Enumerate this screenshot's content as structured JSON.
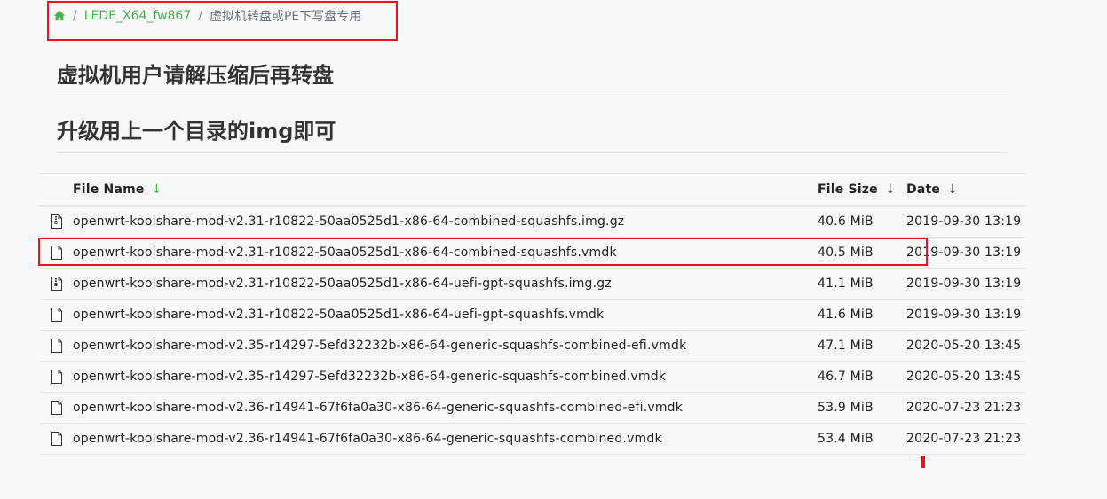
{
  "breadcrumb": {
    "home_icon": "home-icon",
    "separator": "/",
    "items": [
      {
        "label": "LEDE_X64_fw867",
        "color": "#4caf50"
      },
      {
        "label": "虚拟机转盘或PE下写盘专用"
      }
    ]
  },
  "headings": [
    "虚拟机用户请解压缩后再转盘",
    "升级用上一个目录的img即可"
  ],
  "table": {
    "columns": {
      "name": "File Name",
      "name_sort": "↓",
      "size": "File Size",
      "size_sort": "↓",
      "date": "Date",
      "date_sort": "↓"
    },
    "rows": [
      {
        "icon": "archive-icon",
        "name": "openwrt-koolshare-mod-v2.31-r10822-50aa0525d1-x86-64-combined-squashfs.img.gz",
        "size": "40.6 MiB",
        "date": "2019-09-30 13:19"
      },
      {
        "icon": "file-icon",
        "name": "openwrt-koolshare-mod-v2.31-r10822-50aa0525d1-x86-64-combined-squashfs.vmdk",
        "size": "40.5 MiB",
        "date": "2019-09-30 13:19"
      },
      {
        "icon": "archive-icon",
        "name": "openwrt-koolshare-mod-v2.31-r10822-50aa0525d1-x86-64-uefi-gpt-squashfs.img.gz",
        "size": "41.1 MiB",
        "date": "2019-09-30 13:19"
      },
      {
        "icon": "file-icon",
        "name": "openwrt-koolshare-mod-v2.31-r10822-50aa0525d1-x86-64-uefi-gpt-squashfs.vmdk",
        "size": "41.6 MiB",
        "date": "2019-09-30 13:19"
      },
      {
        "icon": "file-icon",
        "name": "openwrt-koolshare-mod-v2.35-r14297-5efd32232b-x86-64-generic-squashfs-combined-efi.vmdk",
        "size": "47.1 MiB",
        "date": "2020-05-20 13:45"
      },
      {
        "icon": "file-icon",
        "name": "openwrt-koolshare-mod-v2.35-r14297-5efd32232b-x86-64-generic-squashfs-combined.vmdk",
        "size": "46.7 MiB",
        "date": "2020-05-20 13:45"
      },
      {
        "icon": "file-icon",
        "name": "openwrt-koolshare-mod-v2.36-r14941-67f6fa0a30-x86-64-generic-squashfs-combined-efi.vmdk",
        "size": "53.9 MiB",
        "date": "2020-07-23 21:23"
      },
      {
        "icon": "file-icon",
        "name": "openwrt-koolshare-mod-v2.36-r14941-67f6fa0a30-x86-64-generic-squashfs-combined.vmdk",
        "size": "53.4 MiB",
        "date": "2020-07-23 21:23"
      }
    ]
  },
  "annotations": {
    "highlight_color": "#e8141e",
    "highlighted_row": 1
  }
}
